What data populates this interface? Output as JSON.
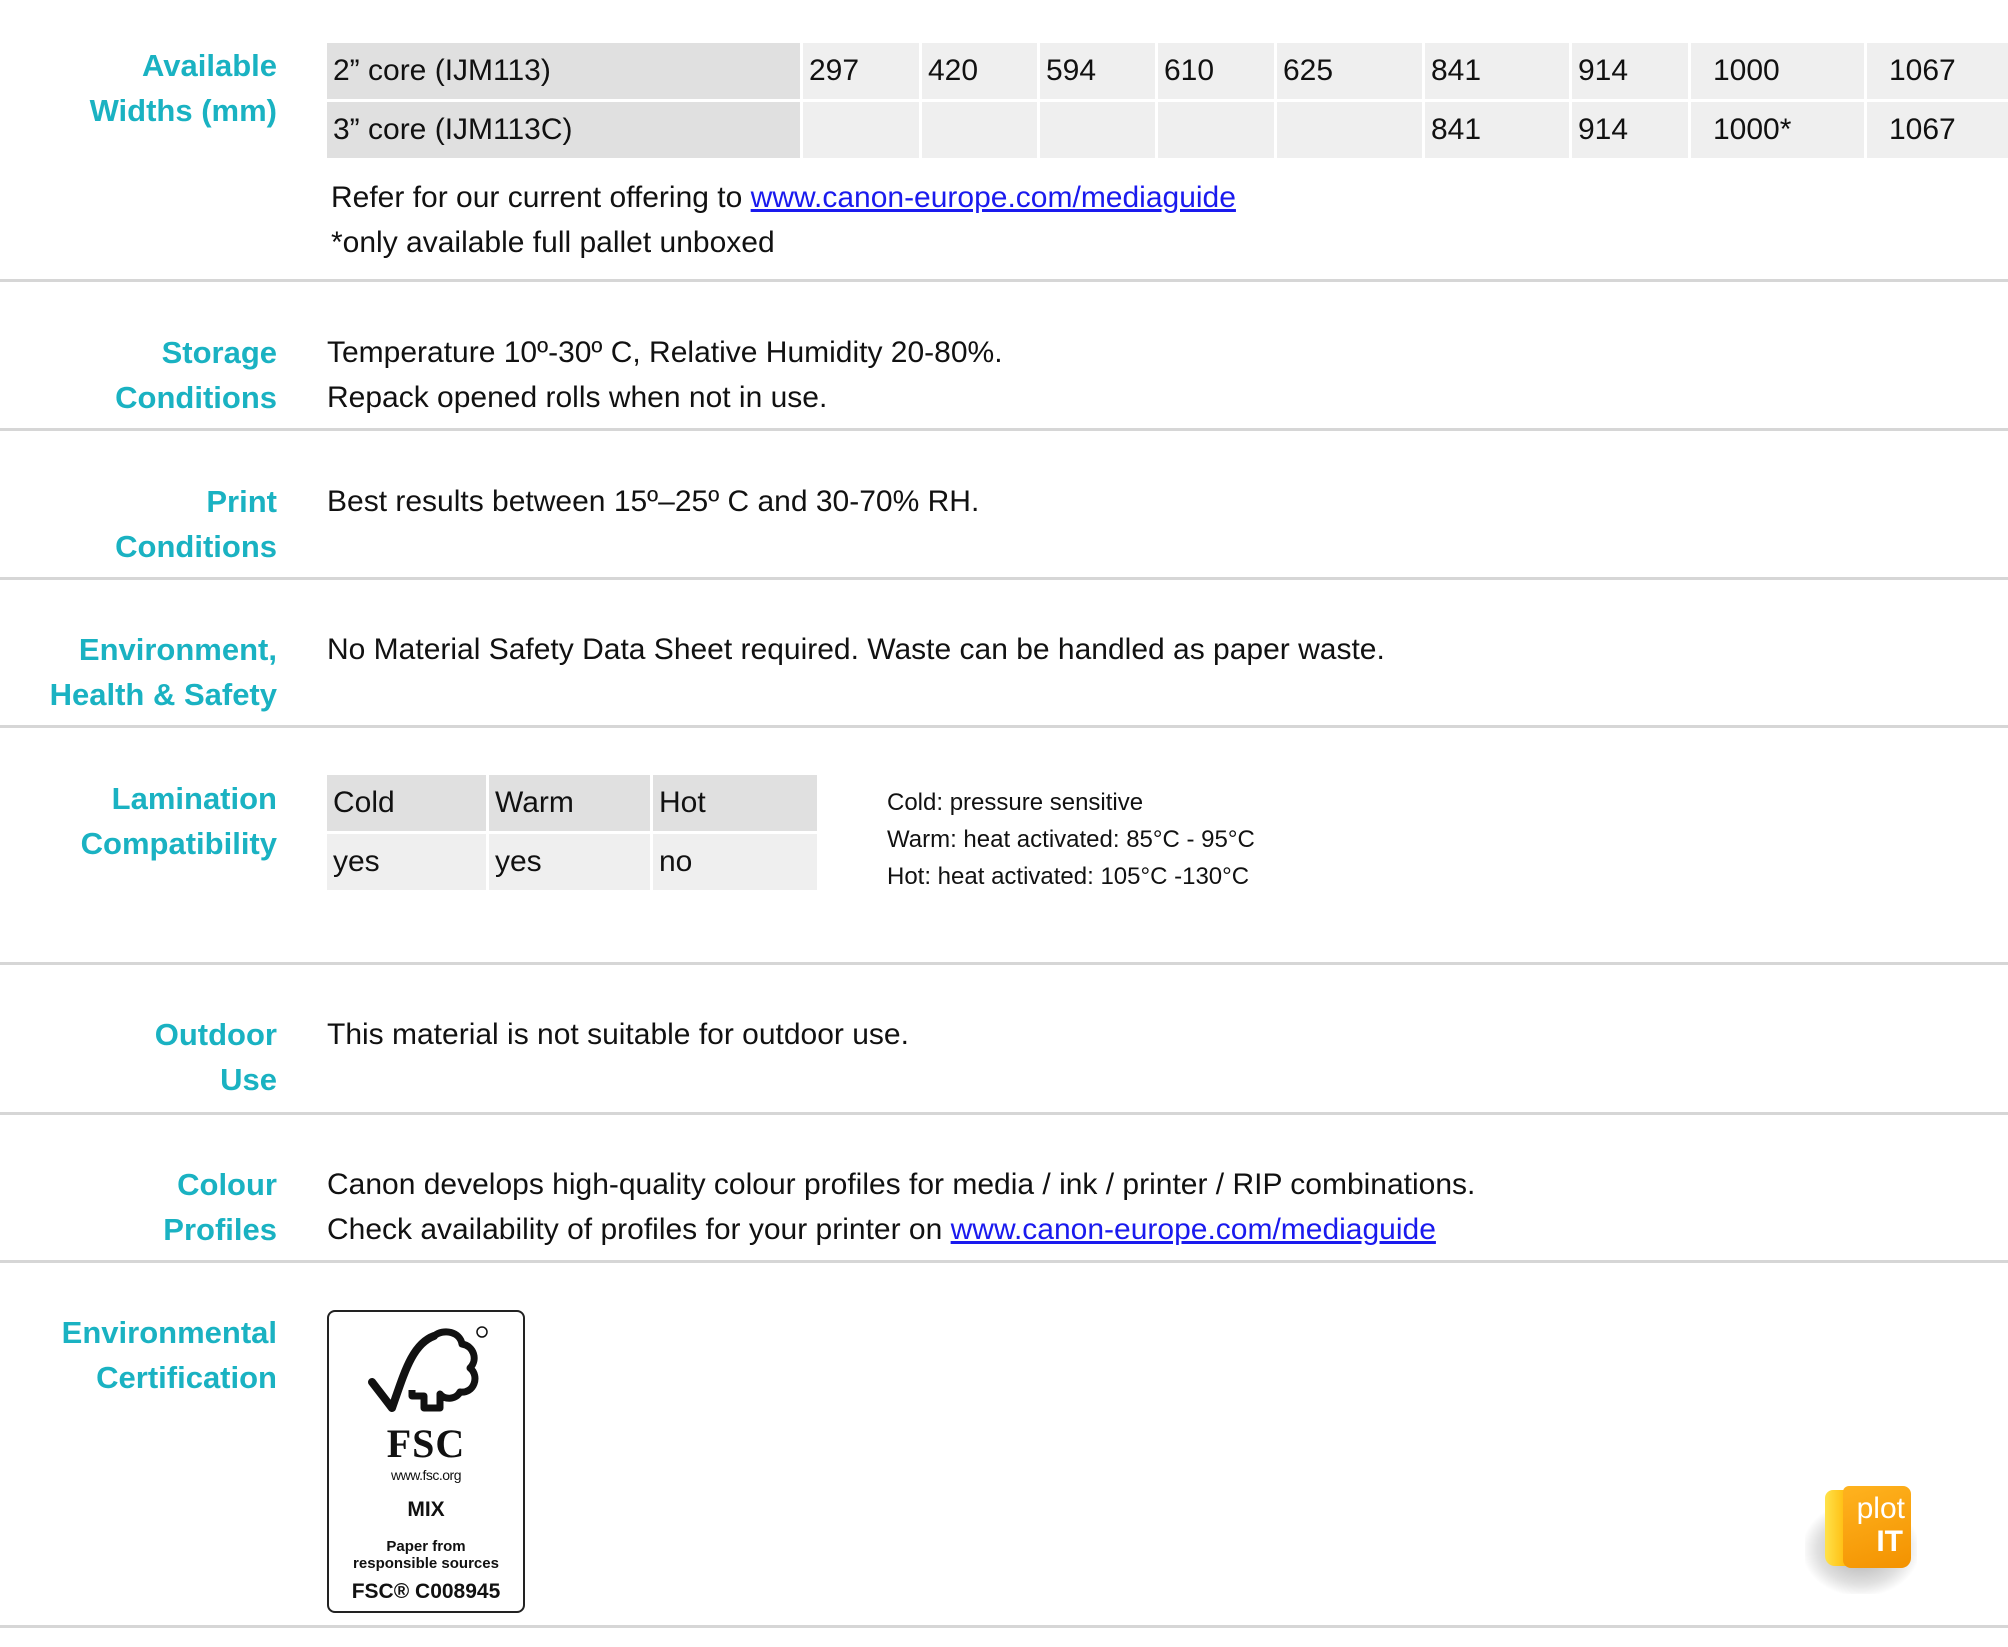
{
  "sections": {
    "widths": {
      "label": [
        "Available",
        "Widths (mm)"
      ],
      "rows": [
        {
          "core": "2” core (IJM113)",
          "values": [
            "297",
            "420",
            "594",
            "610",
            "625",
            "841",
            "914",
            "1000",
            "1067"
          ]
        },
        {
          "core": "3” core (IJM113C)",
          "values": [
            "",
            "",
            "",
            "",
            "",
            "841",
            "914",
            "1000*",
            "1067"
          ]
        }
      ],
      "note_prefix": "Refer for our current offering to ",
      "note_link": "www.canon-europe.com/mediaguide",
      "footnote": "*only available full pallet unboxed"
    },
    "storage": {
      "label": [
        "Storage",
        "Conditions"
      ],
      "lines": [
        "Temperature 10º-30º C, Relative Humidity 20-80%.",
        "Repack opened rolls when not in use."
      ]
    },
    "print": {
      "label": [
        "Print",
        "Conditions"
      ],
      "lines": [
        "Best results between 15º–25º C and 30-70% RH."
      ]
    },
    "ehs": {
      "label": [
        "Environment,",
        "Health & Safety"
      ],
      "lines": [
        "No Material Safety Data Sheet required. Waste can be handled as paper waste."
      ]
    },
    "lamination": {
      "label": [
        "Lamination",
        "Compatibility"
      ],
      "headers": [
        "Cold",
        "Warm",
        "Hot"
      ],
      "values": [
        "yes",
        "yes",
        "no"
      ],
      "legend": [
        "Cold: pressure sensitive",
        "Warm: heat activated: 85°C - 95°C",
        "Hot: heat activated: 105°C -130°C"
      ]
    },
    "outdoor": {
      "label": [
        "Outdoor",
        "Use"
      ],
      "lines": [
        "This material is not suitable for outdoor use."
      ]
    },
    "colour": {
      "label": [
        "Colour",
        "Profiles"
      ],
      "line1": "Canon develops high-quality colour profiles for media / ink / printer / RIP combinations.",
      "line2_prefix": "Check availability of profiles for your printer on ",
      "line2_link": "www.canon-europe.com/mediaguide"
    },
    "certification": {
      "label": [
        "Environmental",
        "Certification"
      ],
      "fsc": {
        "brand": "FSC",
        "url": "www.fsc.org",
        "type": "MIX",
        "desc": [
          "Paper from",
          "responsible sources"
        ],
        "code": "FSC® C008945",
        "registered": "®"
      }
    }
  },
  "logo": {
    "line1": "plot",
    "line2": "IT"
  },
  "colors": {
    "label": "#1ab2c2",
    "link": "#1a1aee",
    "cell_head": "#e0e0e0",
    "cell": "#efefef",
    "divider": "#d6d6d6",
    "logo_orange": "#f39200"
  }
}
